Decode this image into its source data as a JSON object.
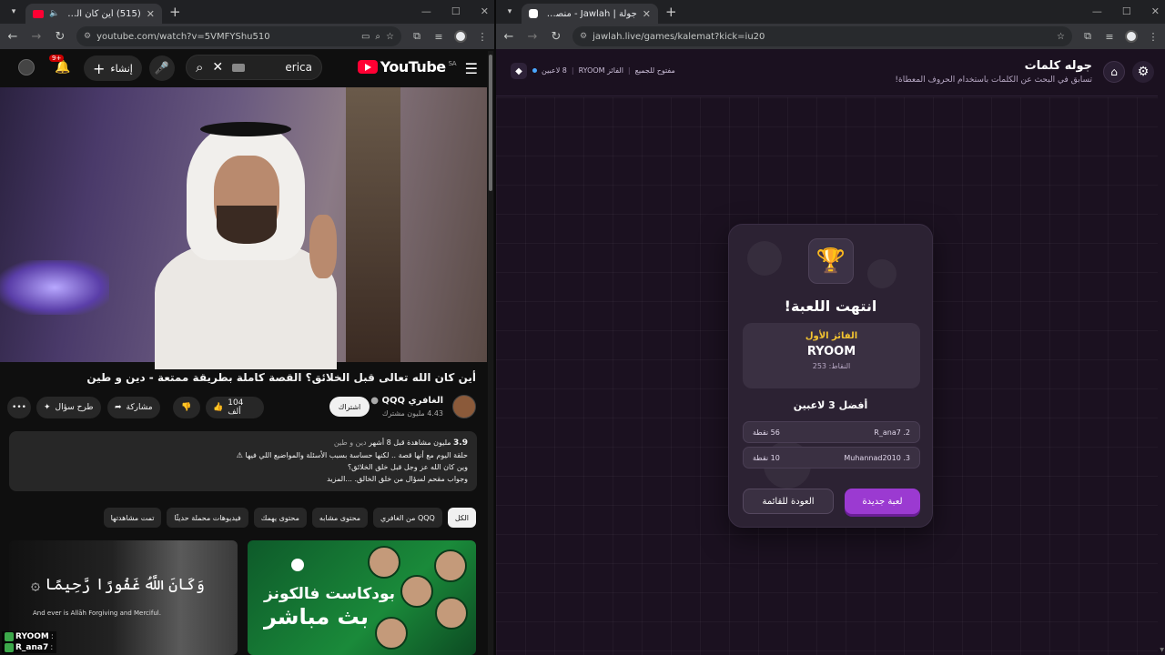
{
  "left_browser": {
    "tab_title": "(515) أين كان الله تعالى قبل ال",
    "url": "youtube.com/watch?v=5VMFYShu510",
    "youtube": {
      "logo_text": "YouTube",
      "region": "SA",
      "search_query": "erica",
      "create_label": "إنشاء",
      "notifications_badge": "9+",
      "video_title": "أين كان الله تعالى قبل الخلائق؟ القصة كاملة بطريقة ممتعة - دين و طين",
      "channel_name": "الغافري QQQ",
      "channel_subs": "4.43 مليون مشترك",
      "subscribe_label": "اشتراك",
      "like_count": "104 ألف",
      "share_label": "مشاركة",
      "ask_label": "طرح سؤال",
      "more_label": "•••",
      "description": {
        "views": "3.9",
        "views_line": "مليون مشاهدة  قبل 8 أشهر",
        "tags": "دين و طين",
        "line1": "حلقة اليوم مع أنها قصة .. لكنها حساسة بسبب الأسئلة والمواضيع اللي فيها ⚠",
        "line2": "وين كان الله عز وجل قبل خلق الخلائق؟",
        "line3": "وجواب مقحم لسؤال من خلق الخالق. ...المزيد"
      },
      "chips": [
        "الكل",
        "من الغافري QQQ",
        "محتوى مشابه",
        "محتوى يهمك",
        "فيديوهات محملة حديثًا",
        "تمت مشاهدتها"
      ],
      "thumb1": {
        "ar": "وَكَانَ اللَّهُ غَفُورًا رَّحِيمًا ۞",
        "en": "And ever is Allāh Forgiving and Merciful."
      },
      "thumb2": {
        "line1": "بودكاست فالكونز",
        "line2": "بث مباشر"
      },
      "chat": [
        {
          "user": "RYOOM",
          "text": ":"
        },
        {
          "user": "R_ana7",
          "text": ":"
        }
      ]
    }
  },
  "right_browser": {
    "tab_title": "جولة | Jawlah - منصة الألعاب الذ",
    "url": "jawlah.live/games/kalemat?kick=iu20",
    "header": {
      "title": "جوله كلمات",
      "subtitle": "تسابق في البحث عن الكلمات باستخدام الحروف المعطاة!",
      "players": "8 لاعبين",
      "winner_tag": "الفائز RYOOM",
      "open_label": "مفتوح للجميع"
    },
    "result": {
      "title": "انتهت اللعبة!",
      "first_label": "الفائز الأول",
      "winner_name": "RYOOM",
      "winner_points": "النقاط: 253",
      "top3_label": "أفضل 3 لاعبين",
      "players": [
        {
          "name": "R_ana7 .2",
          "points": "56 نقطة"
        },
        {
          "name": "Muhannad2010 .3",
          "points": "10 نقطة"
        }
      ],
      "new_game_label": "لعبة جديدة",
      "back_label": "العودة للقائمة"
    }
  }
}
